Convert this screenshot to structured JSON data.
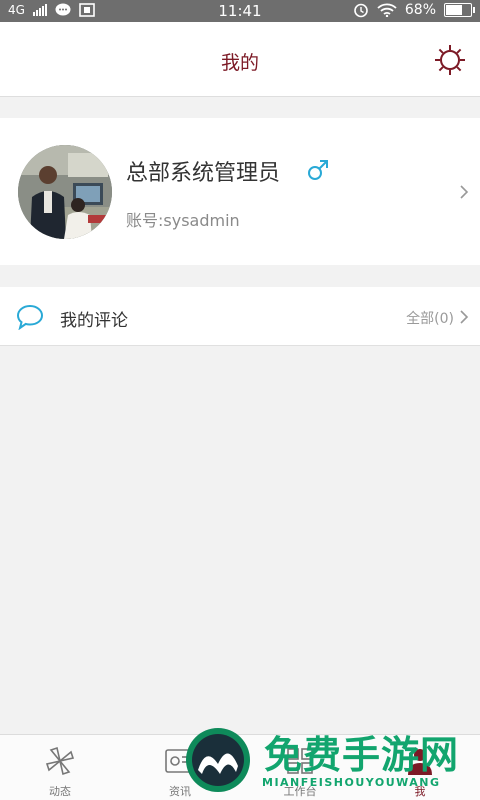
{
  "status_bar": {
    "network": "4G",
    "time": "11:41",
    "battery_percent_label": "68%",
    "battery_level": 0.68
  },
  "header": {
    "title": "我的",
    "settings_icon": "gear-icon"
  },
  "profile": {
    "name": "总部系统管理员",
    "gender_symbol": "♂",
    "account": "账号:sysadmin"
  },
  "comments": {
    "label": "我的评论",
    "all_label": "全部(0)"
  },
  "tabs": [
    {
      "label": "动态",
      "icon": "pinwheel-icon"
    },
    {
      "label": "资讯",
      "icon": "news-icon"
    },
    {
      "label": "工作台",
      "icon": "grid-icon"
    },
    {
      "label": "我",
      "icon": "person-icon"
    }
  ],
  "watermark": {
    "title": "免费手游网",
    "subtitle": "MIANFEISHOUYOUWANG"
  },
  "colors": {
    "accent": "#7c1a26",
    "comment_icon": "#29a9d6",
    "gender": "#29a9d6",
    "watermark": "#12a56e"
  }
}
